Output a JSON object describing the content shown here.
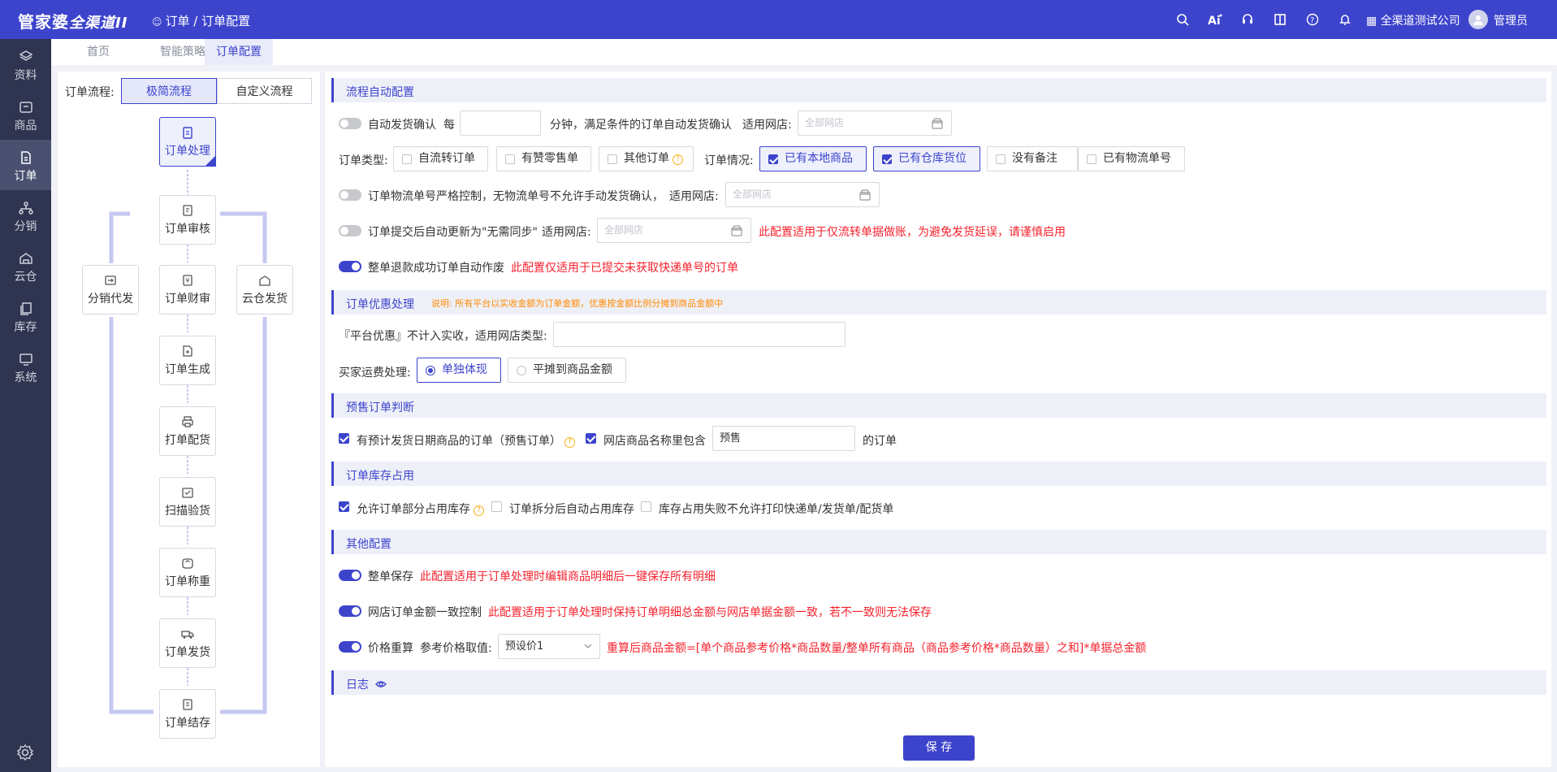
{
  "header": {
    "logo_main": "管家婆",
    "logo_sub": "全渠道II",
    "breadcrumb": "订单 / 订单配置",
    "company": "全渠道测试公司",
    "user": "管理员",
    "tool_icons": [
      "search-icon",
      "ai-icon",
      "headset-icon",
      "book-icon",
      "question-icon",
      "bell-icon",
      "building-icon"
    ]
  },
  "sidebar": {
    "items": [
      {
        "label": "资料",
        "icon": "layers-icon"
      },
      {
        "label": "商品",
        "icon": "box-icon"
      },
      {
        "label": "订单",
        "icon": "document-icon"
      },
      {
        "label": "分销",
        "icon": "network-icon"
      },
      {
        "label": "云仓",
        "icon": "cloud-warehouse-icon"
      },
      {
        "label": "库存",
        "icon": "stack-icon"
      },
      {
        "label": "系统",
        "icon": "monitor-icon"
      }
    ],
    "active": "订单"
  },
  "tabs": [
    "首页",
    "智能策略",
    "订单配置"
  ],
  "flow": {
    "label": "订单流程:",
    "mode_simple": "极简流程",
    "mode_custom": "自定义流程",
    "nodes": {
      "process": "订单处理",
      "audit": "订单审核",
      "distribution": "分销代发",
      "finance": "订单财审",
      "cloud": "云仓发货",
      "generate": "订单生成",
      "print": "打单配货",
      "scan": "扫描验货",
      "weigh": "订单称重",
      "ship": "订单发货",
      "settle": "订单结存"
    }
  },
  "sections": {
    "auto": "流程自动配置",
    "discount": "订单优惠处理",
    "discount_note": "说明: 所有平台以实收金额为订单金额，优惠按金额比例分摊到商品金额中",
    "presale": "预售订单判断",
    "stock": "订单库存占用",
    "other": "其他配置",
    "log": "日志"
  },
  "auto": {
    "auto_confirm": {
      "enabled": false,
      "label": "自动发货确认",
      "every": "每",
      "minutes_value": "",
      "suffix": "分钟，满足条件的订单自动发货确认",
      "shop_label": "适用网店:",
      "shop_placeholder": "全部网店"
    },
    "order_type_label": "订单类型:",
    "order_types": [
      {
        "label": "自流转订单",
        "checked": false
      },
      {
        "label": "有赞零售单",
        "checked": false
      },
      {
        "label": "其他订单",
        "checked": false,
        "help": "?"
      }
    ],
    "order_status_label": "订单情况:",
    "order_status": [
      {
        "label": "已有本地商品",
        "checked": true
      },
      {
        "label": "已有仓库货位",
        "checked": true
      },
      {
        "label": "没有备注",
        "checked": false
      },
      {
        "label": "已有物流单号",
        "checked": false
      }
    ],
    "strict_logistics": {
      "enabled": false,
      "label": "订单物流单号严格控制，无物流单号不允许手动发货确认，",
      "shop_label": "适用网店:",
      "shop_placeholder": "全部网店"
    },
    "no_sync": {
      "enabled": false,
      "label": "订单提交后自动更新为\"无需同步\"",
      "shop_label": "适用网店:",
      "shop_placeholder": "全部网店",
      "warning": "此配置适用于仅流转单据做账，为避免发货延误，请谨慎启用"
    },
    "refund_void": {
      "enabled": true,
      "label": "整单退款成功订单自动作废",
      "warning": "此配置仅适用于已提交未获取快递单号的订单"
    }
  },
  "discount": {
    "platform_label": "『平台优惠』不计入实收，适用网店类型:",
    "platform_value": "",
    "freight_label": "买家运费处理:",
    "freight_options": [
      {
        "label": "单独体现",
        "selected": true
      },
      {
        "label": "平摊到商品金额",
        "selected": false
      }
    ]
  },
  "presale": {
    "expected_date": {
      "checked": true,
      "label": "有预计发货日期商品的订单（预售订单）",
      "help": "?"
    },
    "name_contains": {
      "checked": true,
      "label": "网店商品名称里包含",
      "value": "预售",
      "suffix": "的订单"
    }
  },
  "stock": {
    "partial": {
      "checked": true,
      "label": "允许订单部分占用库存",
      "help": "?"
    },
    "split": {
      "checked": false,
      "label": "订单拆分后自动占用库存"
    },
    "fail": {
      "checked": false,
      "label": "库存占用失败不允许打印快递单/发货单/配货单"
    }
  },
  "other": {
    "whole_save": {
      "enabled": true,
      "label": "整单保存",
      "note": "此配置适用于订单处理时编辑商品明细后一键保存所有明细"
    },
    "amount_consistent": {
      "enabled": true,
      "label": "网店订单金额一致控制",
      "note": "此配置适用于订单处理时保持订单明细总金额与网店单据金额一致，若不一致则无法保存"
    },
    "reprice": {
      "enabled": true,
      "label": "价格重算",
      "ref_label": "参考价格取值:",
      "ref_value": "预设价1",
      "formula": "重算后商品金额=[单个商品参考价格*商品数量/整单所有商品（商品参考价格*商品数量）之和]*单据总金额"
    }
  },
  "save_label": "保 存",
  "colors": {
    "primary": "#3d44cc",
    "sidebar": "#2f3550",
    "warning": "#f5222d",
    "note": "#ff8a00"
  }
}
